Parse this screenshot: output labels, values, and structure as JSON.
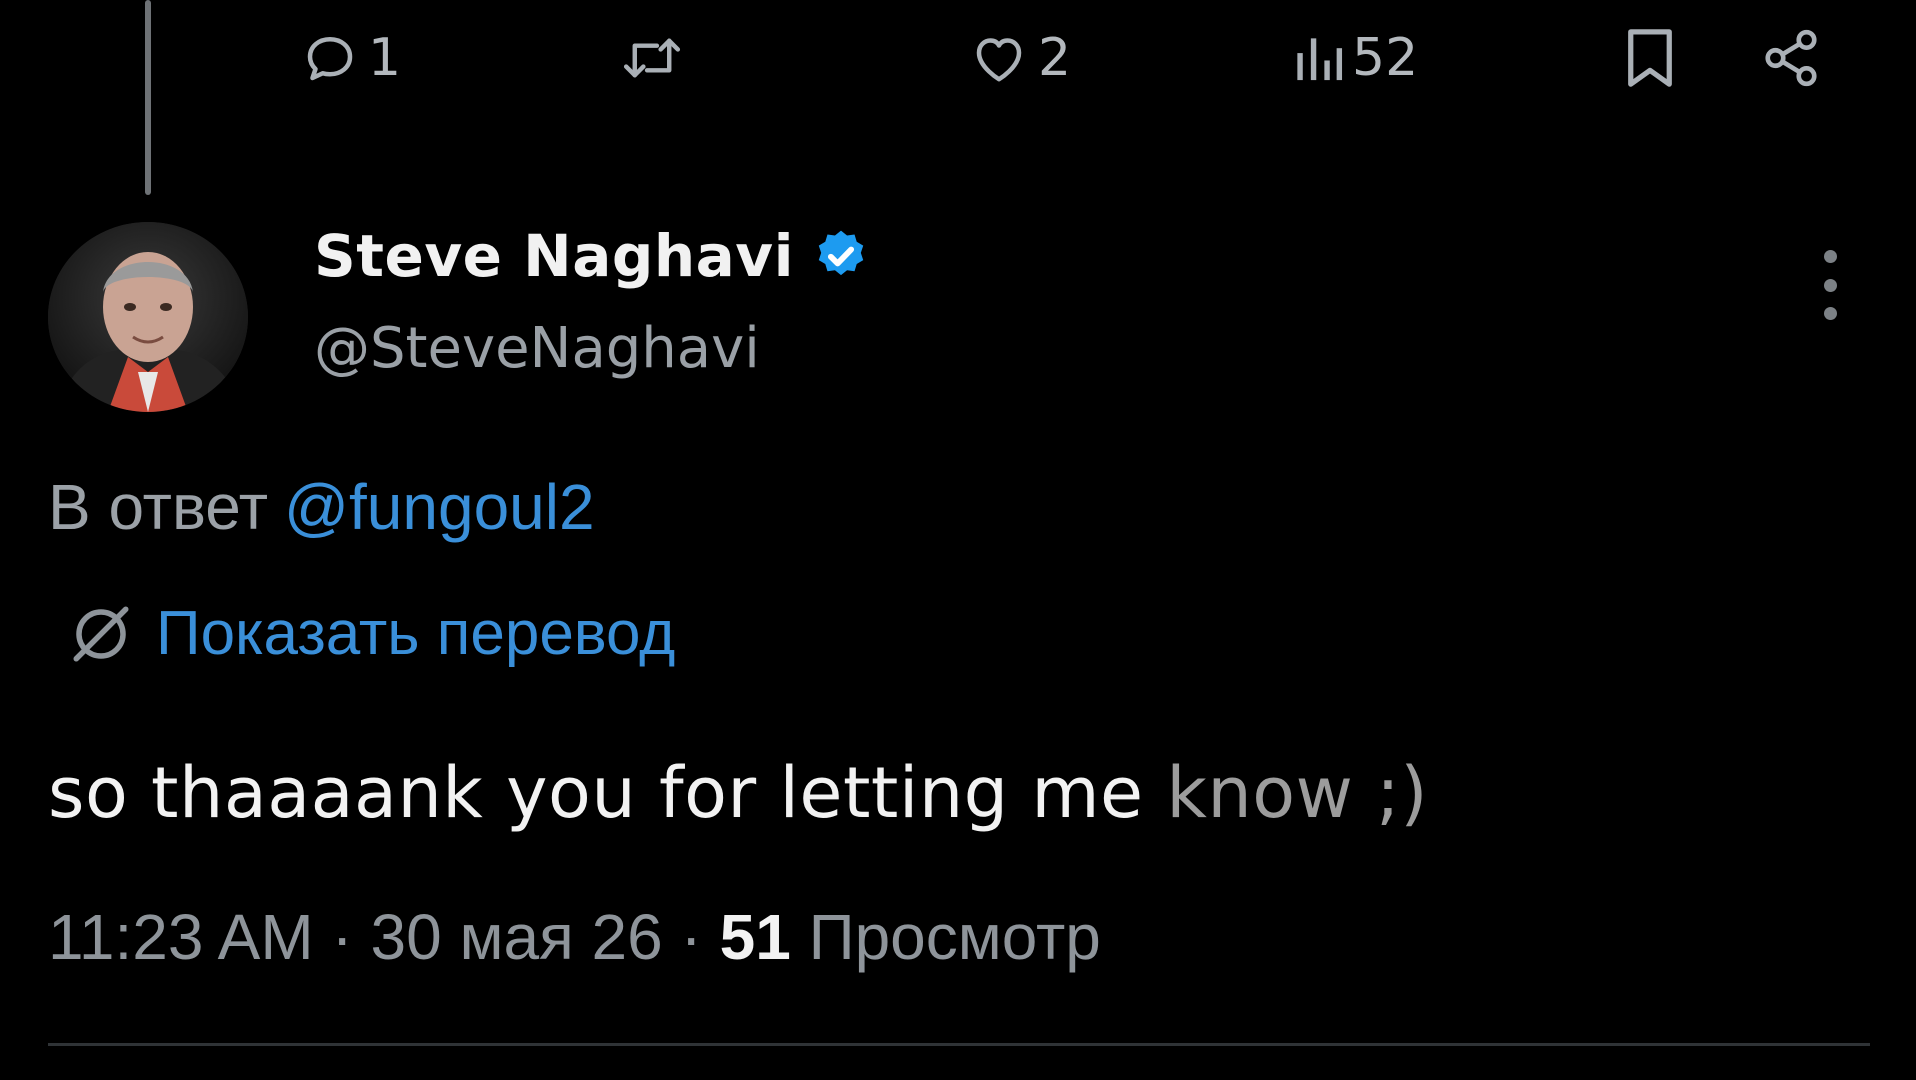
{
  "actions": {
    "reply_count": "1",
    "like_count": "2",
    "views_count": "52"
  },
  "author": {
    "name": "Steve Naghavi",
    "handle": "@SteveNaghavi",
    "verified": true
  },
  "reply_to": {
    "prefix": "В ответ",
    "handle": "@fungoul2"
  },
  "translate": {
    "label": "Показать перевод"
  },
  "tweet": {
    "text_main": "so thaaaank you for letting me ",
    "text_faded": "know ;)"
  },
  "meta": {
    "time": "11:23 AM",
    "separator": " · ",
    "date": "30 мая 26",
    "views_count": "51",
    "views_label": " Просмотр"
  },
  "colors": {
    "background": "#000000",
    "link_blue": "#3a8fd9",
    "verified_blue": "#1d9bf0",
    "muted_text": "#9aa0a6"
  },
  "icons": {
    "reply": "speech-bubble-icon",
    "retweet": "retweet-arrows-icon",
    "like": "heart-icon",
    "views": "bar-chart-icon",
    "bookmark": "bookmark-icon",
    "share": "share-icon",
    "translate": "globe-slash-icon",
    "more": "vertical-dots-icon"
  }
}
